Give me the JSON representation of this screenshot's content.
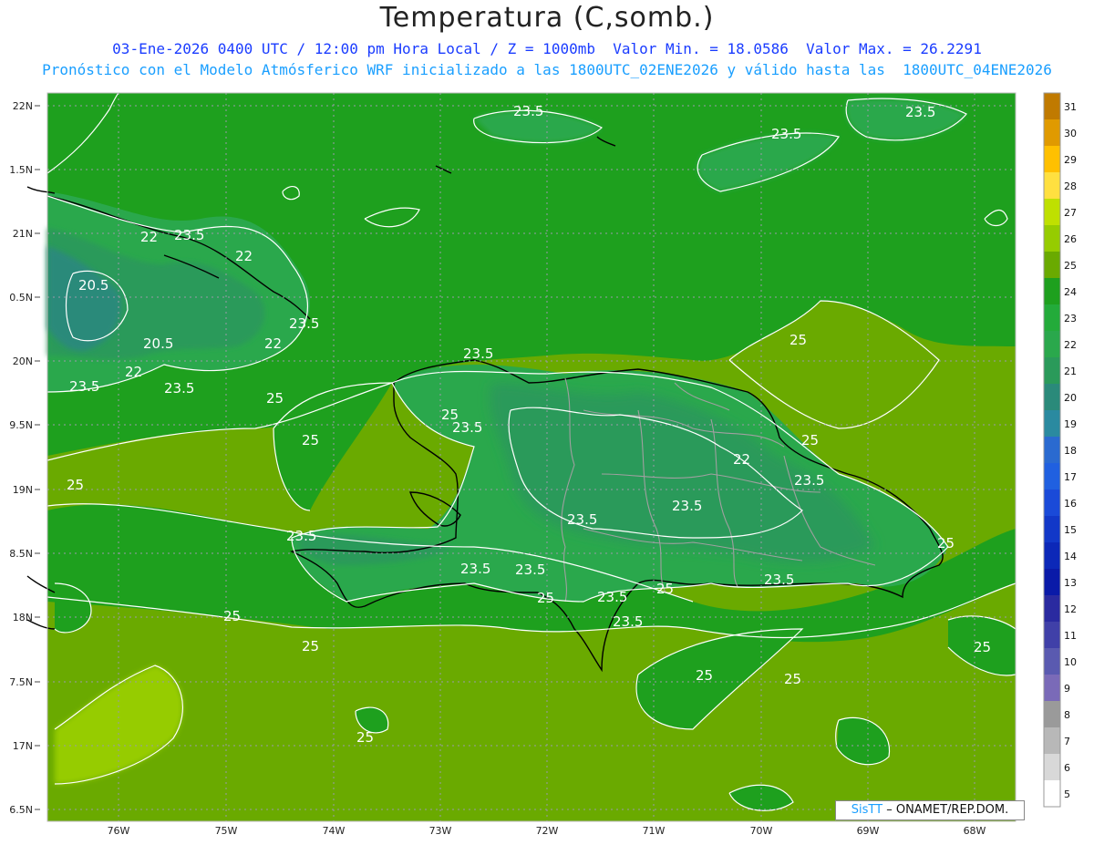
{
  "header": {
    "title": "Temperatura (C,somb.)",
    "line1": "03-Ene-2026 0400 UTC / 12:00 pm Hora Local / Z = 1000mb  Valor Min. = 18.0586  Valor Max. = 26.2291",
    "line2": "Pronóstico con el Modelo Atmósferico WRF inicializado a las 1800UTC_02ENE2026 y válido hasta las  1800UTC_04ENE2026"
  },
  "axes": {
    "lat_labels": [
      "22N",
      "1.5N",
      "21N",
      "0.5N",
      "20N",
      "9.5N",
      "19N",
      "8.5N",
      "18N",
      "7.5N",
      "17N",
      "6.5N"
    ],
    "lon_labels": [
      "76W",
      "75W",
      "74W",
      "73W",
      "72W",
      "71W",
      "70W",
      "69W",
      "68W"
    ]
  },
  "colorbar": {
    "labels": [
      "31",
      "30",
      "29",
      "28",
      "27",
      "26",
      "25",
      "24",
      "23",
      "22",
      "21",
      "20",
      "19",
      "18",
      "17",
      "16",
      "15",
      "14",
      "13",
      "12",
      "11",
      "10",
      "9",
      "8",
      "7",
      "6",
      "5"
    ],
    "colors": [
      "#c07a00",
      "#e09a00",
      "#ffc000",
      "#ffe040",
      "#bfe000",
      "#96cc00",
      "#6aaa00",
      "#1ea01e",
      "#23ab3a",
      "#2aa84c",
      "#2a9a5a",
      "#2a8a7a",
      "#2a8aa0",
      "#2a6ad0",
      "#2060e0",
      "#1a4ad8",
      "#1238c8",
      "#0c28b8",
      "#0a1aa8",
      "#2a2aa0",
      "#4040a8",
      "#5a5ab0",
      "#7a6ab8",
      "#9a9a9a",
      "#b8b8b8",
      "#d8d8d8",
      "#ffffff"
    ]
  },
  "contour_labels": [
    "23.5",
    "23.5",
    "23.5",
    "22",
    "23.5",
    "22",
    "20.5",
    "23.5",
    "20.5",
    "22",
    "22",
    "23.5",
    "23.5",
    "25",
    "23.5",
    "25",
    "25",
    "25",
    "23.5",
    "22",
    "25",
    "23.5",
    "23.5",
    "23.5",
    "23.5",
    "25",
    "23.5",
    "23.5",
    "23.5",
    "25",
    "25",
    "25",
    "23.5",
    "25",
    "25",
    "23.5",
    "25",
    "25",
    "25",
    "25"
  ],
  "credit": {
    "brand": "SisTT",
    "text": "– ONAMET/REP.DOM."
  }
}
